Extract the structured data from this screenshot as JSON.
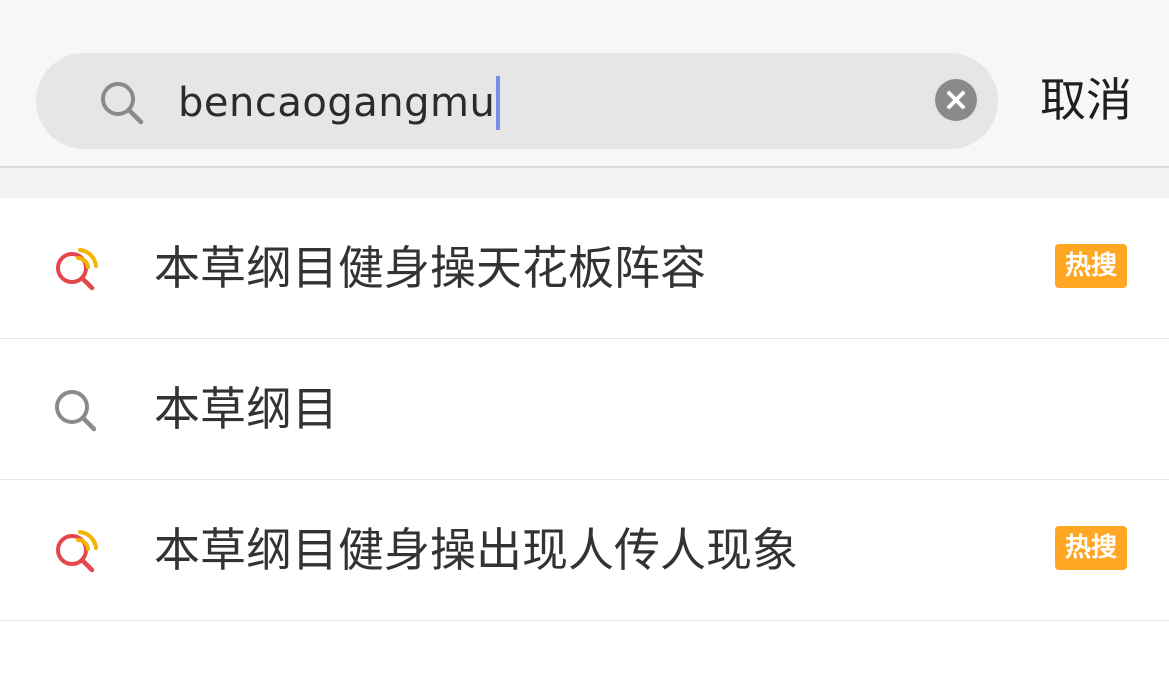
{
  "search": {
    "query": "bencaogangmu",
    "cancel_label": "取消"
  },
  "suggestions": [
    {
      "text": "本草纲目健身操天花板阵容",
      "icon": "hot-search-icon",
      "badge": "热搜"
    },
    {
      "text": "本草纲目",
      "icon": "search-icon",
      "badge": ""
    },
    {
      "text": "本草纲目健身操出现人传人现象",
      "icon": "hot-search-icon",
      "badge": "热搜"
    }
  ],
  "colors": {
    "badge_bg": "#ffa623",
    "hot_icon_red": "#e2474c",
    "hot_icon_yellow": "#f4b400",
    "caret": "#7a8ee8"
  }
}
